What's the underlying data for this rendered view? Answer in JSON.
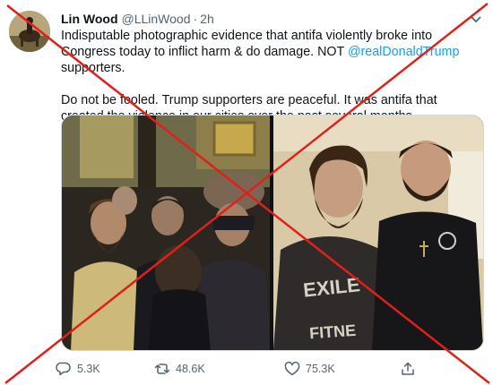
{
  "tweet": {
    "author_name": "Lin Wood",
    "author_handle": "@LLinWood",
    "separator": "·",
    "timestamp": "2h",
    "text_line1_a": "Indisputable photographic evidence that antifa violently broke into Congress today to inflict harm & do damage. NOT ",
    "mention": "@realDonaldTrump",
    "text_line1_b": " supporters.",
    "text_para2": "Do not be fooled. Trump supporters are peaceful. It was antifa that created the violence in our cities over the past several months.",
    "shirt_text_1": "EXILE",
    "shirt_text_2": "FITNE"
  },
  "actions": {
    "replies": "5.3K",
    "retweets": "48.6K",
    "likes": "75.3K"
  },
  "colors": {
    "accent": "#1d9bf0",
    "muted": "#536471",
    "cross": "#e0201b"
  },
  "icons": [
    "chevron-down-icon",
    "reply-icon",
    "retweet-icon",
    "like-icon",
    "share-icon"
  ]
}
